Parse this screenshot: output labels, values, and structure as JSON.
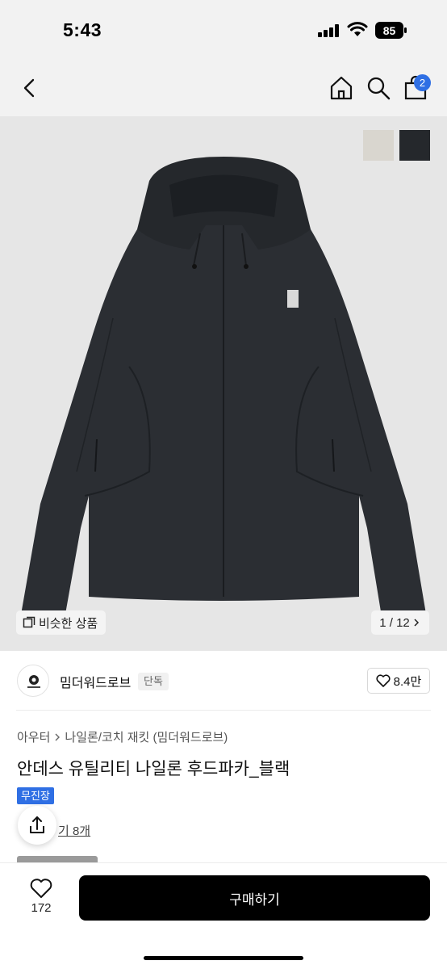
{
  "status_bar": {
    "time": "5:43",
    "battery": "85"
  },
  "nav": {
    "cart_count": "2"
  },
  "gallery": {
    "similar_label": "비슷한 상품",
    "counter": "1 / 12",
    "swatches": [
      "#d9d6cf",
      "#25282c"
    ]
  },
  "seller": {
    "name": "밈더워드로브",
    "badge": "단독",
    "likes": "8.4만"
  },
  "product": {
    "breadcrumb": [
      "아우터",
      "나일론/코치 재킷 (밈더워드로브)"
    ],
    "title": "안데스 유틸리티 나일론 후드파카_블랙",
    "shipping_badge": "무진장",
    "review_link": "기 8개"
  },
  "bottom": {
    "wish_count": "172",
    "buy_label": "구매하기"
  },
  "colors": {
    "accent": "#2f6fe4",
    "buy_button": "#000000",
    "image_bg": "#e6e6e6"
  }
}
